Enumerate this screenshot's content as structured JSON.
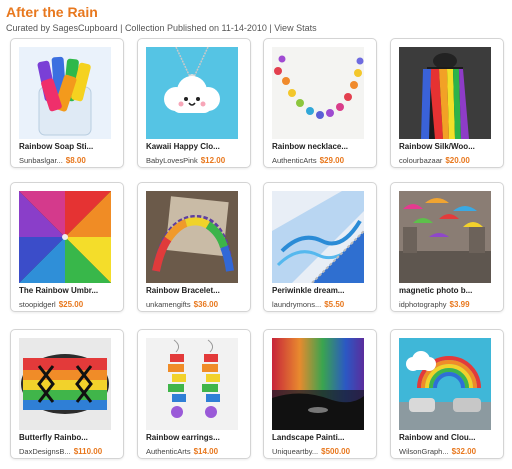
{
  "header": {
    "title": "After the Rain",
    "curated_prefix": "Curated by ",
    "curator": "SagesCupboard",
    "separator": " | ",
    "published": "Collection Published on 11-14-2010",
    "view_stats": "View Stats"
  },
  "items": [
    {
      "name": "Rainbow Soap Sti...",
      "shop": "Sunbaslgar...",
      "price": "$8.00",
      "icon": "soap-sticks"
    },
    {
      "name": "Kawaii Happy Clo...",
      "shop": "BabyLovesPink",
      "price": "$12.00",
      "icon": "cloud-necklace"
    },
    {
      "name": "Rainbow necklace...",
      "shop": "AuthenticArts",
      "price": "$29.00",
      "icon": "bead-necklace"
    },
    {
      "name": "Rainbow Silk/Woo...",
      "shop": "colourbazaar",
      "price": "$20.00",
      "icon": "silk-scarf"
    },
    {
      "name": "The Rainbow Umbr...",
      "shop": "stoopidgerl",
      "price": "$25.00",
      "icon": "umbrella"
    },
    {
      "name": "Rainbow Bracelet...",
      "shop": "unkamengifts",
      "price": "$36.00",
      "icon": "chain-bracelet"
    },
    {
      "name": "Periwinkle dream...",
      "shop": "laundrymons...",
      "price": "$5.50",
      "icon": "fabric-pouch"
    },
    {
      "name": "magnetic photo b...",
      "shop": "idphotography",
      "price": "$3.99",
      "icon": "umbrellas-photo"
    },
    {
      "name": "Butterfly Rainbo...",
      "shop": "DaxDesignsB...",
      "price": "$110.00",
      "icon": "beaded-cuff"
    },
    {
      "name": "Rainbow earrings...",
      "shop": "AuthenticArts",
      "price": "$14.00",
      "icon": "earrings"
    },
    {
      "name": "Landscape Painti...",
      "shop": "Uniqueartby...",
      "price": "$500.00",
      "icon": "landscape-painting"
    },
    {
      "name": "Rainbow and Clou...",
      "shop": "WilsonGraph...",
      "price": "$32.00",
      "icon": "rainbow-decal"
    }
  ],
  "colors": {
    "accent": "#e8781e",
    "text": "#222222",
    "muted": "#555555",
    "card_border": "#d4d4d4"
  }
}
